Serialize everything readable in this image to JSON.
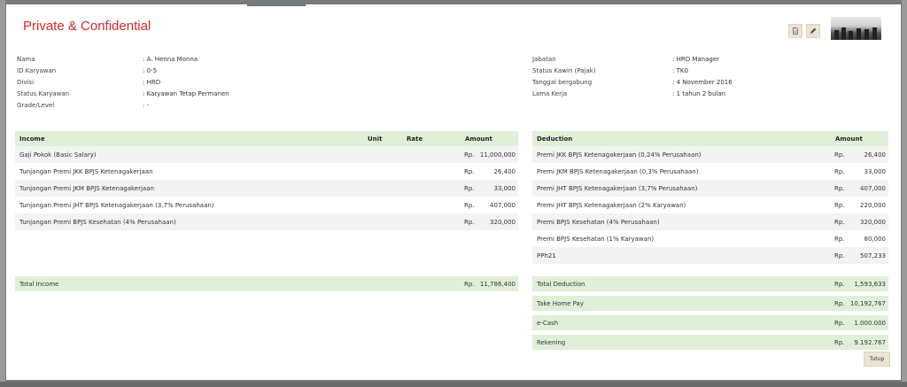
{
  "modal": {
    "title": "Private & Confidential",
    "close_label": "Tutup"
  },
  "toolbar": {
    "icons": [
      "document-icon",
      "pencil-icon"
    ]
  },
  "employee_left": [
    {
      "label": "Nama",
      "value": ": A. Henna Monna"
    },
    {
      "label": "ID Karyawan",
      "value": ": 0-5"
    },
    {
      "label": "Divisi",
      "value": ": HRD"
    },
    {
      "label": "Status Karyawan",
      "value": ": Karyawan Tetap Permanen"
    },
    {
      "label": "Grade/Level",
      "value": ": -"
    }
  ],
  "employee_right": [
    {
      "label": "Jabatan",
      "value": ": HRD Manager"
    },
    {
      "label": "Status Kawin (Pajak)",
      "value": ": TK0"
    },
    {
      "label": "Tanggal bergabung",
      "value": ": 4 November 2016"
    },
    {
      "label": "Lama Kerja",
      "value": ": 1 tahun 2 bulan"
    }
  ],
  "income": {
    "headers": {
      "name": "Income",
      "unit": "Unit",
      "rate": "Rate",
      "amount": "Amount"
    },
    "rows": [
      {
        "name": "Gaji Pokok (Basic Salary)",
        "currency": "Rp.",
        "amount": "11,000,000"
      },
      {
        "name": "Tunjangan Premi JKK BPJS Ketenagakerjaan",
        "currency": "Rp.",
        "amount": "26,400"
      },
      {
        "name": "Tunjangan Premi JKM BPJS Ketenagakerjaan",
        "currency": "Rp.",
        "amount": "33,000"
      },
      {
        "name": "Tunjangan Premi JHT BPJS Ketenagakerjaan (3,7% Perusahaan)",
        "currency": "Rp.",
        "amount": "407,000"
      },
      {
        "name": "Tunjangan Premi BPJS Kesehatan (4% Perusahaan)",
        "currency": "Rp.",
        "amount": "320,000"
      }
    ],
    "total": {
      "name": "Total Income",
      "currency": "Rp.",
      "amount": "11,786,400"
    }
  },
  "deduction": {
    "headers": {
      "name": "Deduction",
      "amount": "Amount"
    },
    "rows": [
      {
        "name": "Premi JKK BPJS Ketenagakerjaan (0,24% Perusahaan)",
        "currency": "Rp.",
        "amount": "26,400"
      },
      {
        "name": "Premi JKM BPJS Ketenagakerjaan (0,3% Perusahaan)",
        "currency": "Rp.",
        "amount": "33,000"
      },
      {
        "name": "Premi JHT BPJS Ketenagakerjaan (3,7% Perusahaan)",
        "currency": "Rp.",
        "amount": "407,000"
      },
      {
        "name": "Premi JHT BPJS Ketenagakerjaan (2% Karyawan)",
        "currency": "Rp.",
        "amount": "220,000"
      },
      {
        "name": "Premi BPJS Kesehatan (4% Perusahaan)",
        "currency": "Rp.",
        "amount": "320,000"
      },
      {
        "name": "Premi BPJS Kesehatan (1% Karyawan)",
        "currency": "Rp.",
        "amount": "80,000"
      },
      {
        "name": "PPh21",
        "currency": "Rp.",
        "amount": "507,233"
      }
    ],
    "summary": [
      {
        "name": "Total Deduction",
        "currency": "Rp.",
        "amount": "1,593,633"
      },
      {
        "name": "Take Home Pay",
        "currency": "Rp.",
        "amount": "10,192,767"
      },
      {
        "name": "e-Cash",
        "currency": "Rp.",
        "amount": "1.000.000"
      },
      {
        "name": "Rekening",
        "currency": "Rp.",
        "amount": "9.192.767"
      }
    ]
  },
  "colors": {
    "title": "#d9272e",
    "header_bg": "#e0f0d8",
    "button_bg": "#ebe3d3"
  }
}
